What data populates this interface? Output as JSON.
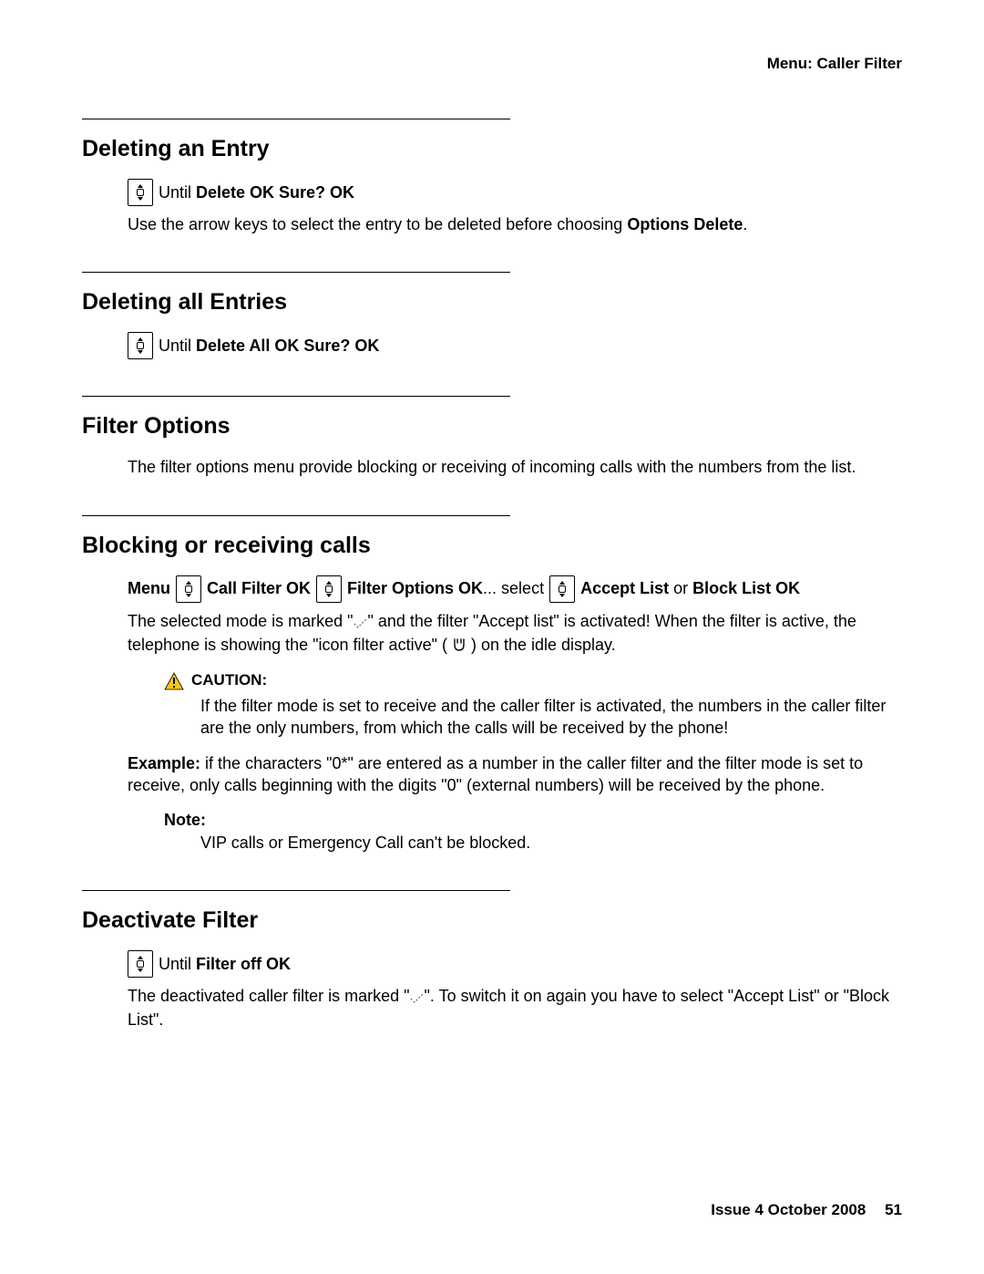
{
  "header": {
    "breadcrumb": "Menu: Caller Filter"
  },
  "sections": {
    "delete_entry": {
      "heading": "Deleting an Entry",
      "step_prefix": "Until ",
      "step_bold": "Delete OK Sure? OK",
      "para_a": "Use the arrow keys to select the entry to be deleted before choosing ",
      "para_b": "Options Delete",
      "para_c": "."
    },
    "delete_all": {
      "heading": "Deleting all Entries",
      "step_prefix": "Until ",
      "step_bold": "Delete All OK Sure? OK"
    },
    "filter_options": {
      "heading": "Filter Options",
      "para": "The filter options menu provide blocking or receiving of incoming calls with the numbers from the list."
    },
    "blocking": {
      "heading": "Blocking or receiving calls",
      "step": {
        "p1": "Menu",
        "p2": "Call Filter OK",
        "p3": "Filter Options OK",
        "p4": "... select",
        "p5": "Accept List",
        "p6": " or ",
        "p7": "Block List OK"
      },
      "para1_a": "The selected mode is marked \"",
      "para1_b": "\" and the filter \"Accept list\" is activated! When the filter is active, the telephone is showing the \"icon filter active\" ( ",
      "para1_c": " ) on the idle display.",
      "caution_label": "CAUTION:",
      "caution_text": "If the filter mode is set to receive and the caller filter is activated, the numbers in the caller filter are the only numbers, from which the calls will be received by the phone!",
      "example_label": "Example:",
      "example_text": " if the characters \"0*\" are entered as a number in the caller filter and the filter mode is set to receive, only calls beginning with the digits \"0\" (external numbers) will be received by the phone.",
      "note_label": "Note:",
      "note_text": "VIP calls or Emergency Call can't be blocked."
    },
    "deactivate": {
      "heading": "Deactivate Filter",
      "step_prefix": "Until ",
      "step_bold": "Filter off OK",
      "para_a": "The deactivated caller filter is marked \"",
      "para_b": "\". To switch it on again you have to select \"Accept List\" or \"Block List\"."
    }
  },
  "footer": {
    "issue": "Issue 4   October 2008",
    "page": "51"
  }
}
